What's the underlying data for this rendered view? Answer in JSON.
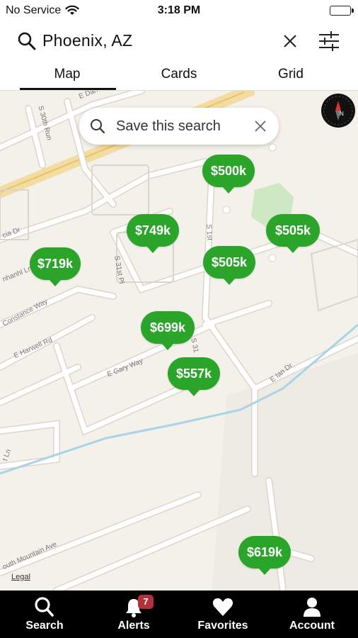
{
  "status_bar": {
    "carrier": "No Service",
    "time": "3:18 PM"
  },
  "search": {
    "query": "Phoenix, AZ"
  },
  "tabs": [
    {
      "label": "Map",
      "active": true
    },
    {
      "label": "Cards",
      "active": false
    },
    {
      "label": "Grid",
      "active": false
    }
  ],
  "map": {
    "save_search_label": "Save this search",
    "legal_label": "Legal",
    "pins": [
      {
        "price": "$500k"
      },
      {
        "price": "$749k"
      },
      {
        "price": "$505k"
      },
      {
        "price": "$719k"
      },
      {
        "price": "$505k"
      },
      {
        "price": "$699k"
      },
      {
        "price": "$557k"
      },
      {
        "price": "$619k"
      }
    ],
    "streets": [
      "E Darrow St",
      "S 30th Run",
      "cia Dr",
      "nhanhl Ln",
      "Constance Way",
      "E Harwell Rd",
      "S 31st Pl",
      "S 1st",
      "E Gary Way",
      "S 31",
      "E Ian Dr",
      "t Ln",
      "outh Mountain Ave"
    ]
  },
  "bottom_nav": {
    "items": [
      {
        "label": "Search",
        "icon": "search-icon"
      },
      {
        "label": "Alerts",
        "icon": "bell-icon",
        "badge": "7"
      },
      {
        "label": "Favorites",
        "icon": "heart-icon"
      },
      {
        "label": "Account",
        "icon": "person-icon"
      }
    ]
  },
  "colors": {
    "pin_green": "#2aa52a",
    "badge_red": "#b3303a",
    "map_bg": "#f3f1ea",
    "park_green": "#cfe8c4"
  }
}
